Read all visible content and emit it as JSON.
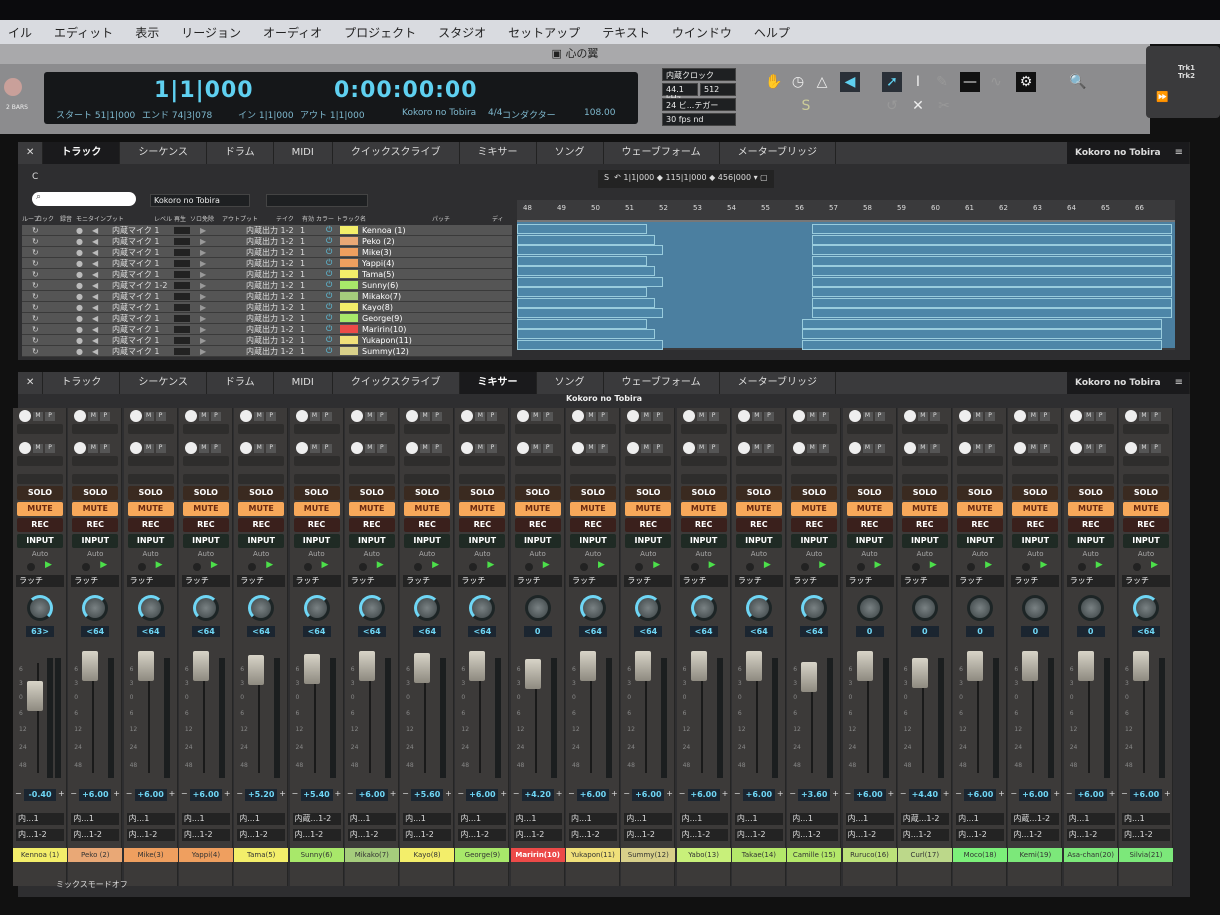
{
  "menu": [
    "イル",
    "エディット",
    "表示",
    "リージョン",
    "オーディオ",
    "プロジェクト",
    "スタジオ",
    "セットアップ",
    "テキスト",
    "ウインドウ",
    "ヘルプ"
  ],
  "window_title": "心の翼",
  "transport": {
    "bars_label": "2 BARS",
    "position_bars": "1|1|000",
    "position_time": "0:00:00:00",
    "start": "スタート 51|1|000",
    "end": "エンド 74|3|078",
    "in": "イン 1|1|000",
    "out": "アウト 1|1|000",
    "song": "Kokoro no Tobira",
    "meter": "4/4",
    "conductor": "コンダクター",
    "tempo": "108.00",
    "clock": "内蔵クロック",
    "sample_rate": "44.1 kHz",
    "buffer": "512",
    "bit_depth": "24 ビ...テガー",
    "fps": "30 fps nd"
  },
  "float_panel": {
    "trk": "Trk1 Trk2"
  },
  "tabs": [
    "トラック",
    "シーケンス",
    "ドラム",
    "MIDI",
    "クイックスクライブ",
    "ミキサー",
    "ソング",
    "ウェーブフォーム",
    "メーターブリッジ"
  ],
  "top_panel": {
    "active_tab": 0,
    "song_menu": "Kokoro no Tobira",
    "c_label": "C",
    "filter_select": "Kokoro no Tobira",
    "nav": {
      "s": "S",
      "a": "1|1|000",
      "b": "115|1|000",
      "c": "456|000"
    },
    "columns": [
      "ループ",
      "ロック",
      "録音",
      "モニタ",
      "インプット",
      "レベル",
      "再生",
      "ソロ免除",
      "アウトプット",
      "テイク",
      "有効",
      "カラー",
      "トラック名",
      "パッチ",
      "ディ"
    ],
    "ruler": [
      "48",
      "49",
      "50",
      "51",
      "52",
      "53",
      "54",
      "55",
      "56",
      "57",
      "58",
      "59",
      "60",
      "61",
      "62",
      "63",
      "64",
      "65",
      "66"
    ],
    "tracks": [
      {
        "input": "内蔵マイク 1",
        "output": "内蔵出力 1-2",
        "take": "1",
        "color": "#f3ee6a",
        "name": "Kennoa (1)"
      },
      {
        "input": "内蔵マイク 1",
        "output": "内蔵出力 1-2",
        "take": "1",
        "color": "#e9a876",
        "name": "Peko (2)"
      },
      {
        "input": "内蔵マイク 1",
        "output": "内蔵出力 1-2",
        "take": "1",
        "color": "#ef9f5f",
        "name": "Mike(3)"
      },
      {
        "input": "内蔵マイク 1",
        "output": "内蔵出力 1-2",
        "take": "1",
        "color": "#ef9f5f",
        "name": "Yappi(4)"
      },
      {
        "input": "内蔵マイク 1",
        "output": "内蔵出力 1-2",
        "take": "1",
        "color": "#f3ee6a",
        "name": "Tama(5)"
      },
      {
        "input": "内蔵マイク 1-2",
        "output": "内蔵出力 1-2",
        "take": "1",
        "color": "#a8e86a",
        "name": "Sunny(6)"
      },
      {
        "input": "内蔵マイク 1",
        "output": "内蔵出力 1-2",
        "take": "1",
        "color": "#a5cc7c",
        "name": "Mikako(7)"
      },
      {
        "input": "内蔵マイク 1",
        "output": "内蔵出力 1-2",
        "take": "1",
        "color": "#f3ee6a",
        "name": "Kayo(8)"
      },
      {
        "input": "内蔵マイク 1",
        "output": "内蔵出力 1-2",
        "take": "1",
        "color": "#a8e86a",
        "name": "George(9)"
      },
      {
        "input": "内蔵マイク 1",
        "output": "内蔵出力 1-2",
        "take": "1",
        "color": "#ec4a48",
        "name": "Maririn(10)"
      },
      {
        "input": "内蔵マイク 1",
        "output": "内蔵出力 1-2",
        "take": "1",
        "color": "#f0e07a",
        "name": "Yukapon(11)"
      },
      {
        "input": "内蔵マイク 1",
        "output": "内蔵出力 1-2",
        "take": "1",
        "color": "#d8d08a",
        "name": "Summy(12)"
      }
    ]
  },
  "mixer": {
    "active_tab": 5,
    "song_menu": "Kokoro no Tobira",
    "title": "Kokoro no Tobira",
    "solo": "SOLO",
    "mute": "MUTE",
    "rec": "REC",
    "input": "INPUT",
    "auto": "Auto",
    "latch": "ラッチ",
    "ins_m": "M",
    "ins_p": "P",
    "scale": [
      "6",
      "3",
      "0",
      "6",
      "12",
      "24",
      "48"
    ],
    "mix_mode": "ミックスモードオフ",
    "channels": [
      {
        "name": "Kennoa (1)",
        "color": "#f3ee6a",
        "pan": "63>",
        "gain": "-0.40",
        "in": "内...1",
        "out": "内...1-2"
      },
      {
        "name": "Peko (2)",
        "color": "#e9a876",
        "pan": "<64",
        "gain": "+6.00",
        "in": "内...1",
        "out": "内...1-2"
      },
      {
        "name": "Mike(3)",
        "color": "#ef9f5f",
        "pan": "<64",
        "gain": "+6.00",
        "in": "内...1",
        "out": "内...1-2"
      },
      {
        "name": "Yappi(4)",
        "color": "#ef9f5f",
        "pan": "<64",
        "gain": "+6.00",
        "in": "内...1",
        "out": "内...1-2"
      },
      {
        "name": "Tama(5)",
        "color": "#f3ee6a",
        "pan": "<64",
        "gain": "+5.20",
        "in": "内...1",
        "out": "内...1-2"
      },
      {
        "name": "Sunny(6)",
        "color": "#a8e86a",
        "pan": "<64",
        "gain": "+5.40",
        "in": "内蔵...1-2",
        "out": "内...1-2"
      },
      {
        "name": "Mikako(7)",
        "color": "#a5cc7c",
        "pan": "<64",
        "gain": "+6.00",
        "in": "内...1",
        "out": "内...1-2"
      },
      {
        "name": "Kayo(8)",
        "color": "#f3ee6a",
        "pan": "<64",
        "gain": "+5.60",
        "in": "内...1",
        "out": "内...1-2"
      },
      {
        "name": "George(9)",
        "color": "#a8e86a",
        "pan": "<64",
        "gain": "+6.00",
        "in": "内...1",
        "out": "内...1-2"
      },
      {
        "name": "Maririn(10)",
        "color": "#ec4a48",
        "pan": "0",
        "gain": "+4.20",
        "in": "内...1",
        "out": "内...1-2"
      },
      {
        "name": "Yukapon(11)",
        "color": "#f0e07a",
        "pan": "<64",
        "gain": "+6.00",
        "in": "内...1",
        "out": "内...1-2"
      },
      {
        "name": "Summy(12)",
        "color": "#d8d08a",
        "pan": "<64",
        "gain": "+6.00",
        "in": "内...1",
        "out": "内...1-2"
      },
      {
        "name": "Yabo(13)",
        "color": "#c8f07a",
        "pan": "<64",
        "gain": "+6.00",
        "in": "内...1",
        "out": "内...1-2"
      },
      {
        "name": "Takae(14)",
        "color": "#b4e86a",
        "pan": "<64",
        "gain": "+6.00",
        "in": "内...1",
        "out": "内...1-2"
      },
      {
        "name": "Camille (15)",
        "color": "#b4e86a",
        "pan": "<64",
        "gain": "+3.60",
        "in": "内...1",
        "out": "内...1-2"
      },
      {
        "name": "Ruruco(16)",
        "color": "#bce27a",
        "pan": "0",
        "gain": "+6.00",
        "in": "内...1",
        "out": "内...1-2"
      },
      {
        "name": "Curl(17)",
        "color": "#bcd88a",
        "pan": "0",
        "gain": "+4.40",
        "in": "内蔵...1-2",
        "out": "内...1-2"
      },
      {
        "name": "Moco(18)",
        "color": "#7cf07a",
        "pan": "0",
        "gain": "+6.00",
        "in": "内...1",
        "out": "内...1-2"
      },
      {
        "name": "Kemi(19)",
        "color": "#7ce87a",
        "pan": "0",
        "gain": "+6.00",
        "in": "内蔵...1-2",
        "out": "内...1-2"
      },
      {
        "name": "Asa-chan(20)",
        "color": "#7ce87a",
        "pan": "0",
        "gain": "+6.00",
        "in": "内...1",
        "out": "内...1-2"
      },
      {
        "name": "Silvia(21)",
        "color": "#7ce87a",
        "pan": "<64",
        "gain": "+6.00",
        "in": "内...1",
        "out": "内...1-2"
      }
    ]
  },
  "colors": {
    "accent": "#5fd0f0",
    "mute": "#f7a85a",
    "solo_bg": "#3a2a20",
    "rec_bg": "#3a201c",
    "input_bg": "#1f2a24"
  }
}
